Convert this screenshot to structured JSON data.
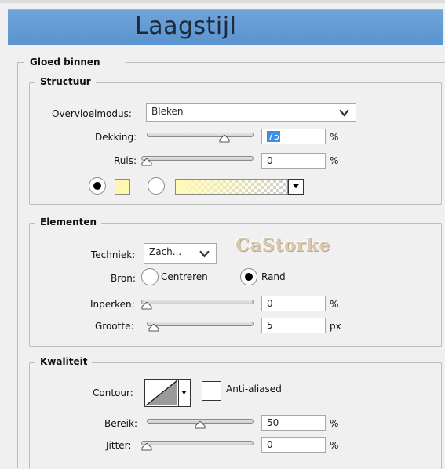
{
  "window": {
    "title": "Laagstijl"
  },
  "section": {
    "title": "Gloed binnen"
  },
  "structuur": {
    "title": "Structuur",
    "blend_label": "Overvloeimodus:",
    "blend_value": "Bleken",
    "opacity_label": "Dekking:",
    "opacity_value": "75",
    "opacity_unit": "%",
    "opacity_level": 0.75,
    "noise_label": "Ruis:",
    "noise_value": "0",
    "noise_unit": "%",
    "noise_level": 0.0,
    "solid_color": "#fff7b0",
    "gradient_from": "#fff9b8",
    "color_radio_selected": true
  },
  "elementen": {
    "title": "Elementen",
    "technique_label": "Techniek:",
    "technique_value": "Zach...",
    "source_label": "Bron:",
    "source_option1": "Centreren",
    "source_option2": "Rand",
    "source_selected": "Rand",
    "choke_label": "Inperken:",
    "choke_value": "0",
    "choke_unit": "%",
    "choke_level": 0.0,
    "size_label": "Grootte:",
    "size_value": "5",
    "size_unit": "px",
    "size_level": 0.02,
    "watermark": "CaStorke"
  },
  "kwaliteit": {
    "title": "Kwaliteit",
    "contour_label": "Contour:",
    "antialias_label": "Anti-aliased",
    "antialias_checked": false,
    "range_label": "Bereik:",
    "range_value": "50",
    "range_unit": "%",
    "range_level": 0.5,
    "jitter_label": "Jitter:",
    "jitter_value": "0",
    "jitter_unit": "%",
    "jitter_level": 0.0
  }
}
